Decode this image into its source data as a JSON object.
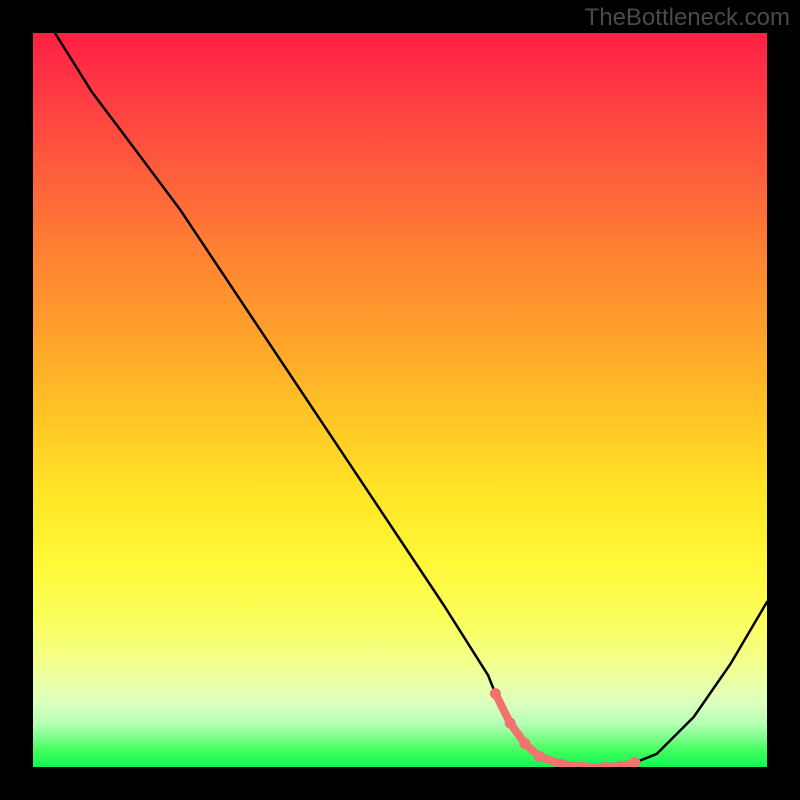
{
  "watermark": "TheBottleneck.com",
  "chart_data": {
    "type": "line",
    "title": "",
    "xlabel": "",
    "ylabel": "",
    "xlim": [
      0,
      100
    ],
    "ylim": [
      0,
      100
    ],
    "series": [
      {
        "name": "bottleneck-curve",
        "x": [
          3,
          8,
          14,
          20,
          26,
          32,
          38,
          44,
          50,
          56,
          62,
          63,
          65,
          67,
          69,
          72,
          75,
          78,
          80,
          82,
          85,
          90,
          95,
          100
        ],
        "y": [
          100,
          92,
          84,
          76,
          67,
          58,
          49,
          40,
          31,
          22,
          12.5,
          10,
          6,
          3.2,
          1.4,
          0.4,
          0,
          0,
          0.1,
          0.6,
          1.8,
          6.8,
          14,
          22.5
        ],
        "color": "#000000"
      },
      {
        "name": "optimal-range-highlight",
        "x": [
          63,
          65,
          67,
          69,
          72,
          75,
          78,
          80,
          82
        ],
        "y": [
          10,
          6,
          3.2,
          1.4,
          0.4,
          0,
          0,
          0.1,
          0.6
        ],
        "color": "#f0736f",
        "marker": "dot"
      }
    ],
    "gradient_stops": [
      {
        "pos": 0,
        "color": "#ff1f42"
      },
      {
        "pos": 50,
        "color": "#ffc726"
      },
      {
        "pos": 80,
        "color": "#fbff5c"
      },
      {
        "pos": 100,
        "color": "#13f453"
      }
    ]
  }
}
